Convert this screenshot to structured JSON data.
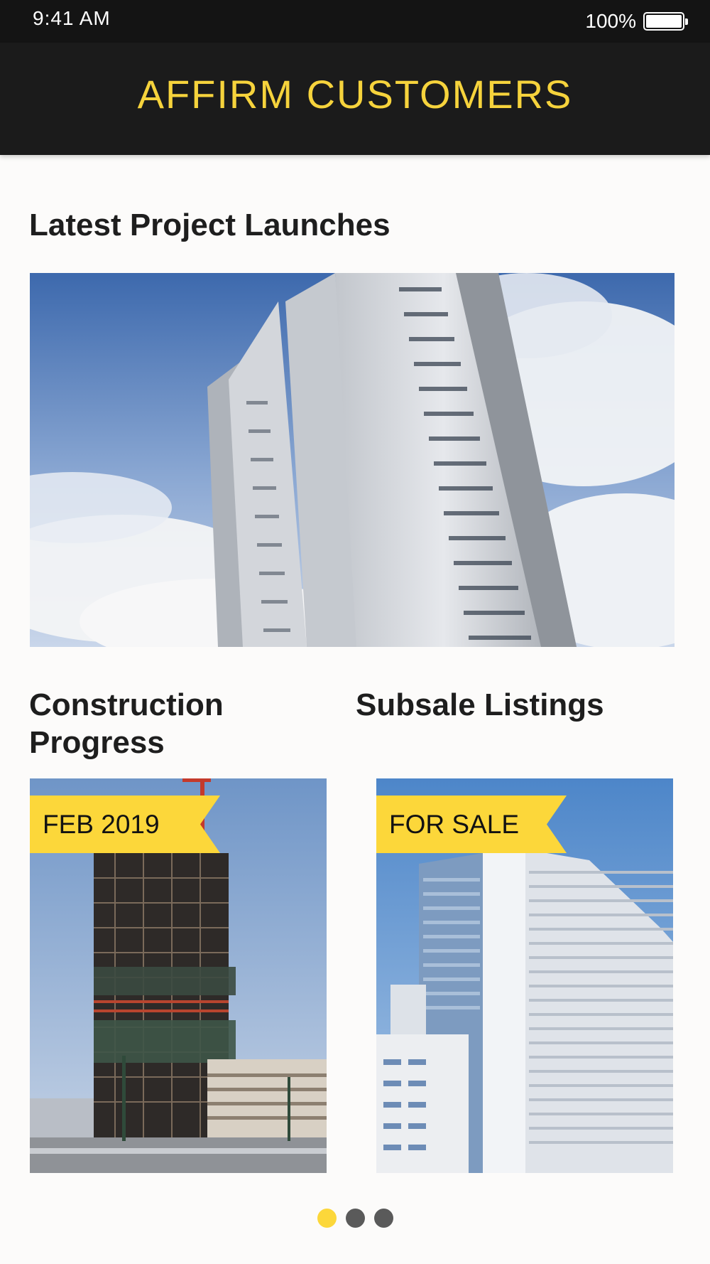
{
  "status_bar": {
    "time": "9:41 AM",
    "battery": "100%",
    "battery_level": 1.0
  },
  "header": {
    "title": "AFFIRM CUSTOMERS",
    "accent_color": "#f6d33c",
    "background": "#1b1b1b"
  },
  "latest_launches": {
    "title": "Latest Project Launches"
  },
  "construction": {
    "title": "Construction Progress",
    "badge": "FEB 2019"
  },
  "subsale": {
    "title": "Subsale Listings",
    "badge": "FOR SALE"
  },
  "pager": {
    "count": 3,
    "active_index": 0,
    "active_color": "#fcd73a",
    "inactive_color": "#5a5a5a"
  }
}
